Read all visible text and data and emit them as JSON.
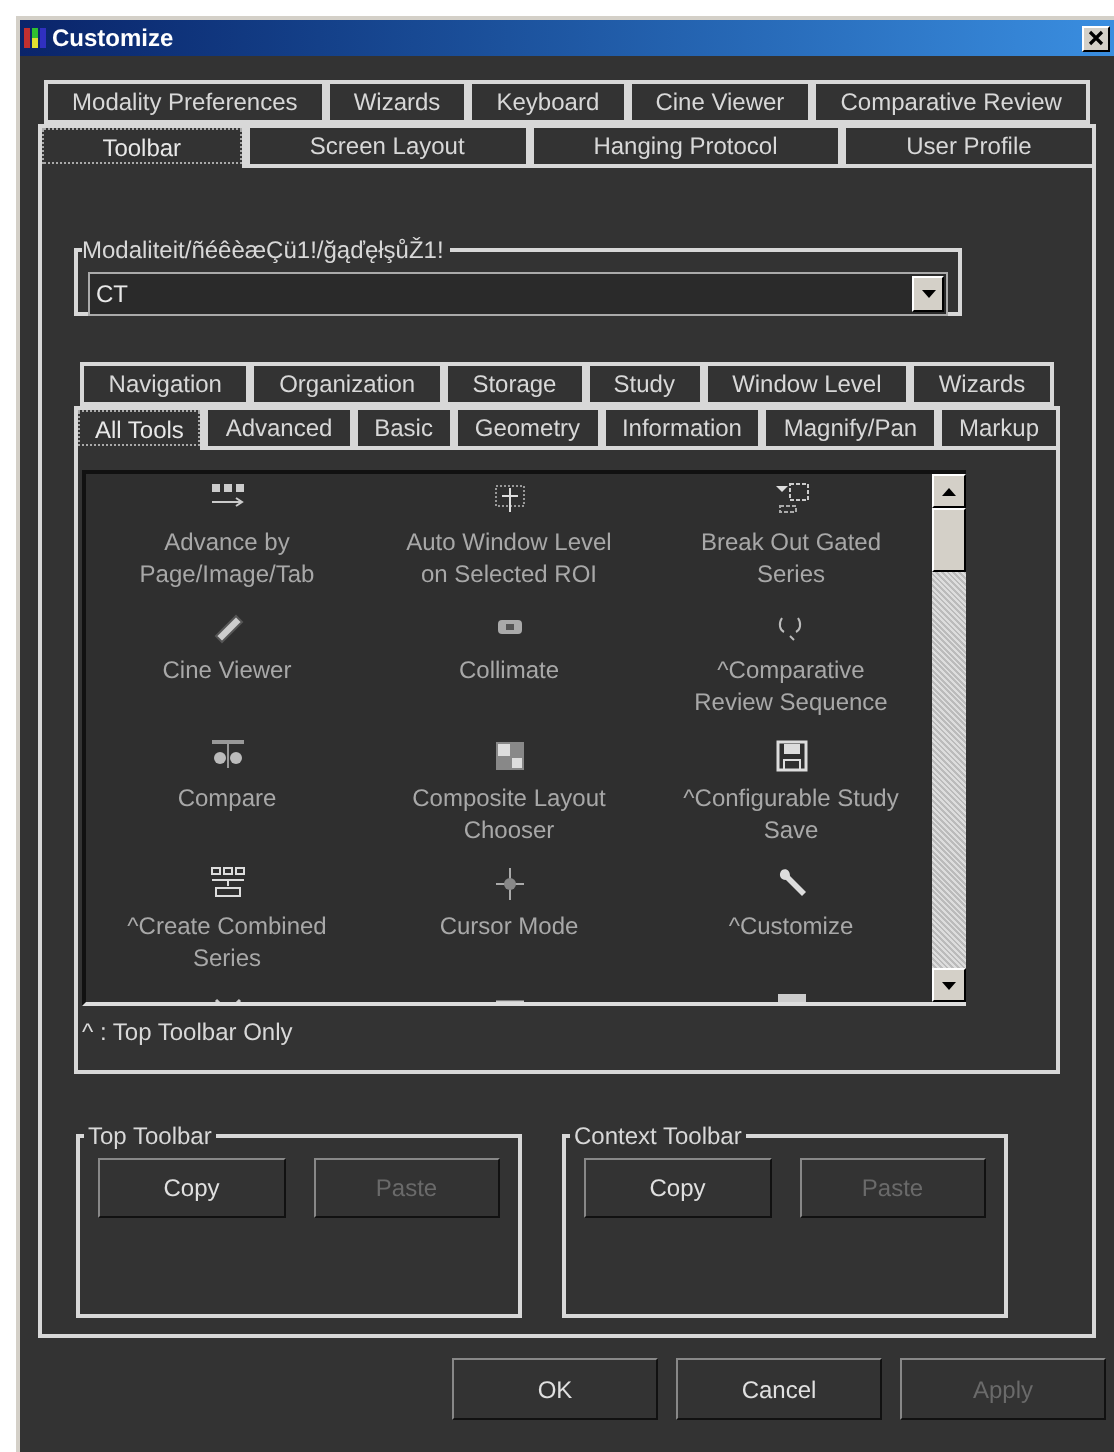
{
  "window": {
    "title": "Customize"
  },
  "tab_rows": [
    [
      {
        "label": "Modality Preferences",
        "selected": false
      },
      {
        "label": "Wizards",
        "selected": false
      },
      {
        "label": "Keyboard",
        "selected": false
      },
      {
        "label": "Cine Viewer",
        "selected": false
      },
      {
        "label": "Comparative Review",
        "selected": false
      }
    ],
    [
      {
        "label": "Toolbar",
        "selected": true
      },
      {
        "label": "Screen Layout",
        "selected": false
      },
      {
        "label": "Hanging Protocol",
        "selected": false
      },
      {
        "label": "User Profile",
        "selected": false
      }
    ]
  ],
  "modality": {
    "label": "Modaliteit/ñéêèæÇü1!/ğąďęłşůŽ1!",
    "value": "CT"
  },
  "tool_tab_rows": [
    [
      {
        "label": "Navigation",
        "selected": false
      },
      {
        "label": "Organization",
        "selected": false
      },
      {
        "label": "Storage",
        "selected": false
      },
      {
        "label": "Study",
        "selected": false
      },
      {
        "label": "Window Level",
        "selected": false
      },
      {
        "label": "Wizards",
        "selected": false
      }
    ],
    [
      {
        "label": "All Tools",
        "selected": true
      },
      {
        "label": "Advanced",
        "selected": false
      },
      {
        "label": "Basic",
        "selected": false
      },
      {
        "label": "Geometry",
        "selected": false
      },
      {
        "label": "Information",
        "selected": false
      },
      {
        "label": "Magnify/Pan",
        "selected": false
      },
      {
        "label": "Markup",
        "selected": false
      }
    ]
  ],
  "tools": [
    {
      "label": "Advance by Page/Image/Tab"
    },
    {
      "label": "Auto Window Level on Selected ROI"
    },
    {
      "label": "Break Out Gated Series"
    },
    {
      "label": "Cine Viewer"
    },
    {
      "label": "Collimate"
    },
    {
      "label": "^Comparative Review Sequence"
    },
    {
      "label": "Compare"
    },
    {
      "label": "Composite Layout Chooser"
    },
    {
      "label": "^Configurable Study Save"
    },
    {
      "label": "^Create Combined Series"
    },
    {
      "label": "Cursor Mode"
    },
    {
      "label": "^Customize"
    }
  ],
  "footnote": "^ : Top Toolbar Only",
  "groups": [
    {
      "title": "Top Toolbar",
      "buttons": [
        {
          "label": "Copy",
          "disabled": false
        },
        {
          "label": "Paste",
          "disabled": true
        }
      ]
    },
    {
      "title": "Context Toolbar",
      "buttons": [
        {
          "label": "Copy",
          "disabled": false
        },
        {
          "label": "Paste",
          "disabled": true
        }
      ]
    }
  ],
  "dialog_buttons": [
    {
      "label": "OK",
      "disabled": false
    },
    {
      "label": "Cancel",
      "disabled": false
    },
    {
      "label": "Apply",
      "disabled": true
    }
  ]
}
